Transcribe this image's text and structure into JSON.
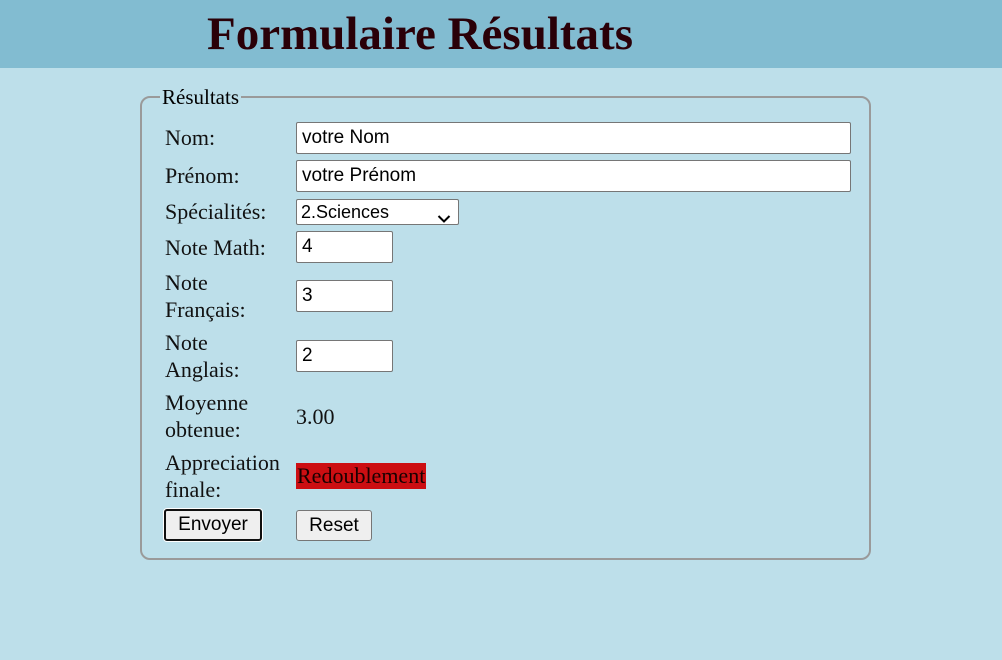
{
  "header": {
    "title": "Formulaire Résultats"
  },
  "form": {
    "legend": "Résultats",
    "nom": {
      "label": "Nom:",
      "value": "votre Nom"
    },
    "prenom": {
      "label": "Prénom:",
      "value": "votre Prénom"
    },
    "specialites": {
      "label": "Spécialités:",
      "selected": "2.Sciences",
      "icon": "chevron-down-icon"
    },
    "note_math": {
      "label": "Note Math:",
      "value": "4"
    },
    "note_francais": {
      "label_line1": "Note",
      "label_line2": "Français:",
      "value": "3"
    },
    "note_anglais": {
      "label_line1": "Note",
      "label_line2": "Anglais:",
      "value": "2"
    },
    "moyenne": {
      "label_line1": "Moyenne",
      "label_line2": "obtenue:",
      "value": "3.00"
    },
    "appreciation": {
      "label_line1": "Appreciation",
      "label_line2": "finale:",
      "value": "Redoublement",
      "highlight_color": "#cc0e12"
    },
    "buttons": {
      "submit_label": "Envoyer",
      "reset_label": "Reset"
    }
  },
  "colors": {
    "page_background": "#bddfea",
    "header_background": "#82bcd1",
    "title_color": "#2a0008"
  }
}
